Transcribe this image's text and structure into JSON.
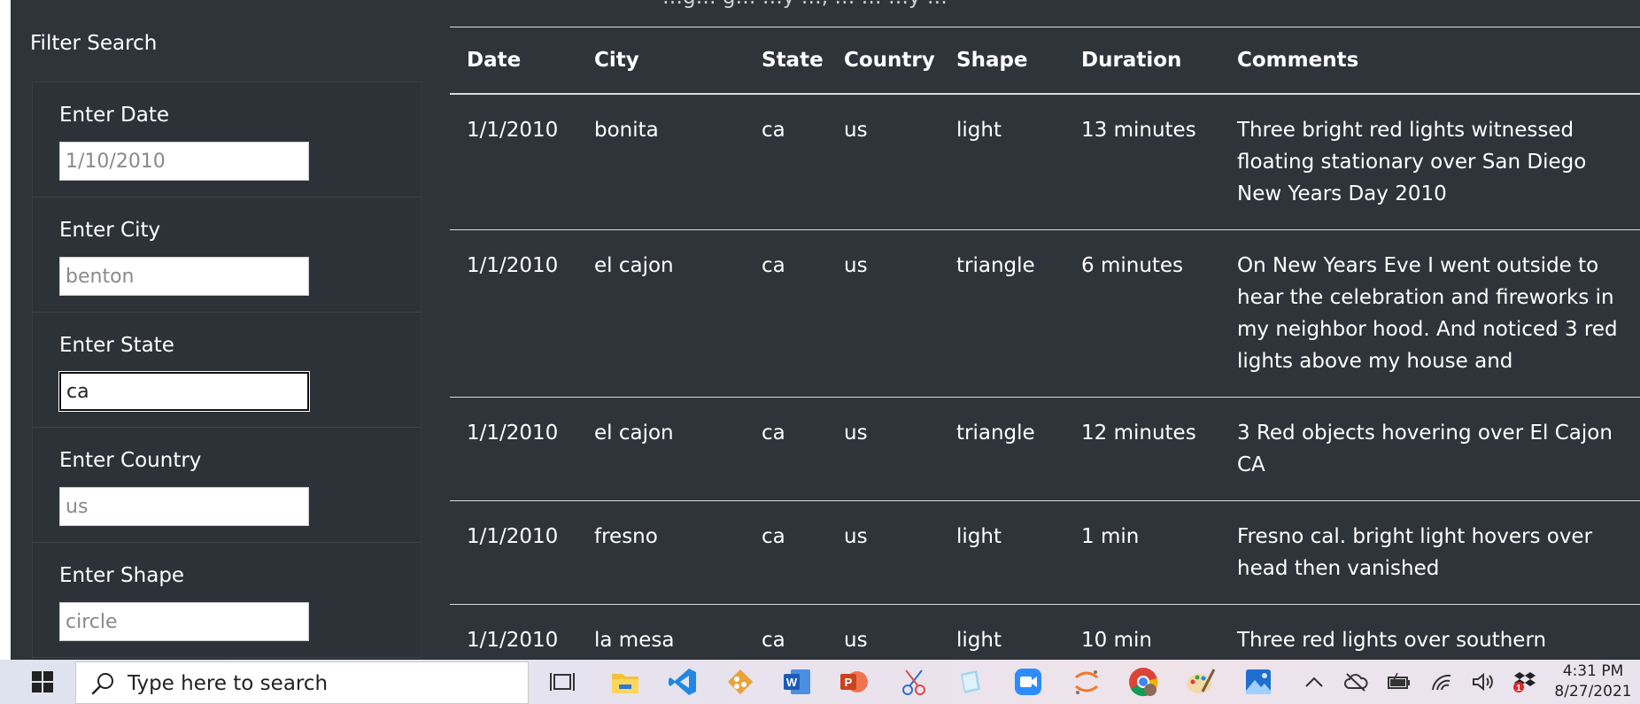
{
  "sidebar": {
    "title": "Filter Search",
    "filters": [
      {
        "label": "Enter Date",
        "placeholder": "1/10/2010",
        "value": ""
      },
      {
        "label": "Enter City",
        "placeholder": "benton",
        "value": ""
      },
      {
        "label": "Enter State",
        "placeholder": "",
        "value": "ca"
      },
      {
        "label": "Enter Country",
        "placeholder": "us",
        "value": ""
      },
      {
        "label": "Enter Shape",
        "placeholder": "circle",
        "value": ""
      }
    ]
  },
  "table": {
    "top_cut_text": "…g… g… …y …, … … …y …",
    "headers": [
      "Date",
      "City",
      "State",
      "Country",
      "Shape",
      "Duration",
      "Comments"
    ],
    "rows": [
      [
        "1/1/2010",
        "bonita",
        "ca",
        "us",
        "light",
        "13 minutes",
        "Three bright red lights witnessed floating stationary over San Diego New Years Day 2010"
      ],
      [
        "1/1/2010",
        "el cajon",
        "ca",
        "us",
        "triangle",
        "6 minutes",
        "On New Years Eve I went outside to hear the celebration and fireworks in my neighbor hood. And noticed 3 red lights above my house and"
      ],
      [
        "1/1/2010",
        "el cajon",
        "ca",
        "us",
        "triangle",
        "12 minutes",
        "3 Red objects hovering over El Cajon CA"
      ],
      [
        "1/1/2010",
        "fresno",
        "ca",
        "us",
        "light",
        "1 min",
        "Fresno cal. bright light hovers over head then vanished"
      ],
      [
        "1/1/2010",
        "la mesa",
        "ca",
        "us",
        "light",
        "10 min",
        "Three red lights over southern California that made a triangle shape"
      ]
    ]
  },
  "taskbar": {
    "search_placeholder": "Type here to search",
    "apps": [
      "task-view-icon",
      "file-explorer-icon",
      "vscode-icon",
      "git-icon",
      "word-icon",
      "powerpoint-icon",
      "snipping-icon",
      "notepad-icon",
      "zoom-icon",
      "jupyter-icon",
      "chrome-icon",
      "paint-icon",
      "photos-icon"
    ],
    "tray": [
      "chevron-up-icon",
      "cloud-icon",
      "battery-icon",
      "wifi-icon",
      "volume-icon",
      "dropbox-icon"
    ],
    "clock_time": "4:31 PM",
    "clock_date": "8/27/2021",
    "notification_badge": "1"
  }
}
